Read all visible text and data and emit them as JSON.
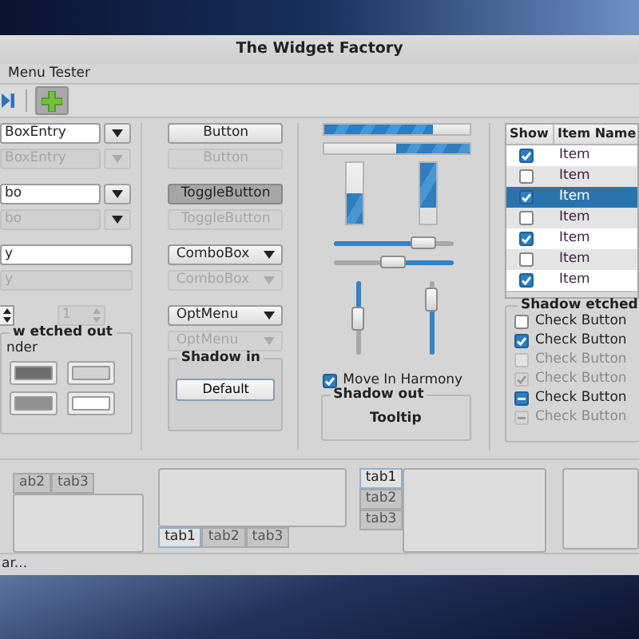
{
  "window": {
    "title": "The Widget Factory"
  },
  "menu": [
    "Menu Tester"
  ],
  "toolbar": [
    {
      "pressed": false
    },
    {
      "pressed": true
    }
  ],
  "entries": [
    {
      "kind": "combo-entry",
      "value": "BoxEntry",
      "disabled": false
    },
    {
      "kind": "combo-entry",
      "value": "BoxEntry",
      "disabled": true
    },
    {
      "kind": "combo",
      "value": "bo",
      "disabled": false
    },
    {
      "kind": "combo",
      "value": "bo",
      "disabled": true
    },
    {
      "kind": "entry",
      "value": "y",
      "disabled": false
    },
    {
      "kind": "entry",
      "value": "y",
      "disabled": true
    }
  ],
  "spins": [
    {
      "disabled": false
    },
    {
      "value": "1",
      "disabled": true
    }
  ],
  "etched_out_frame": {
    "label": "w etched out",
    "sublabel": "nder",
    "swatches": [
      {
        "color": "#6e6e6e"
      },
      {
        "color": "#d2d2d2"
      },
      {
        "color": "#8f8f8f"
      },
      {
        "color": "#ffffff"
      }
    ]
  },
  "buttons": [
    {
      "kind": "button",
      "label": "Button",
      "disabled": false,
      "pressed": false
    },
    {
      "kind": "button",
      "label": "Button",
      "disabled": true,
      "pressed": false
    },
    {
      "kind": "toggle",
      "label": "ToggleButton",
      "disabled": false,
      "pressed": true
    },
    {
      "kind": "toggle",
      "label": "ToggleButton",
      "disabled": true,
      "pressed": false
    },
    {
      "kind": "combo",
      "label": "ComboBox",
      "disabled": false,
      "pressed": false
    },
    {
      "kind": "combo",
      "label": "ComboBox",
      "disabled": true,
      "pressed": false
    },
    {
      "kind": "optmenu",
      "label": "OptMenu",
      "disabled": false,
      "pressed": false
    },
    {
      "kind": "optmenu",
      "label": "OptMenu",
      "disabled": true,
      "pressed": false
    }
  ],
  "shadow_in_frame": {
    "label": "Shadow in",
    "button": "Default"
  },
  "progress_bars": [
    {
      "kind": "horizontal",
      "inverted": false,
      "level": 0.75
    },
    {
      "kind": "horizontal",
      "inverted": true,
      "level": 0.5
    },
    {
      "kind": "vertical",
      "inverted": false,
      "level": 0.5
    },
    {
      "kind": "vertical",
      "inverted": true,
      "level": 0.73
    }
  ],
  "scales": [
    {
      "kind": "horizontal",
      "inverted": false,
      "level": 0.75
    },
    {
      "kind": "horizontal",
      "inverted": true,
      "level": 0.5
    },
    {
      "kind": "vertical",
      "inverted": true,
      "level": 0.5
    },
    {
      "kind": "vertical",
      "inverted": false,
      "level": 0.76
    }
  ],
  "harmony": {
    "label": "Move In Harmony",
    "checked": true
  },
  "shadow_out_frame": {
    "label": "Shadow out",
    "text": "Tooltip"
  },
  "tree": {
    "columns": [
      "Show",
      "Item Name"
    ],
    "rows": [
      {
        "checked": true,
        "name": "Item",
        "selected": false
      },
      {
        "checked": false,
        "name": "Item",
        "selected": false
      },
      {
        "checked": true,
        "name": "Item",
        "selected": true
      },
      {
        "checked": false,
        "name": "Item",
        "selected": false
      },
      {
        "checked": true,
        "name": "Item",
        "selected": false
      },
      {
        "checked": false,
        "name": "Item",
        "selected": false
      },
      {
        "checked": true,
        "name": "Item",
        "selected": false
      }
    ]
  },
  "shadow_etched_frame": {
    "label": "Shadow etched",
    "checks": [
      {
        "label": "Check Button",
        "checked": false,
        "inconsistent": false,
        "disabled": false
      },
      {
        "label": "Check Button",
        "checked": true,
        "inconsistent": false,
        "disabled": false
      },
      {
        "label": "Check Button",
        "checked": false,
        "inconsistent": false,
        "disabled": true
      },
      {
        "label": "Check Button",
        "checked": true,
        "inconsistent": false,
        "disabled": true
      },
      {
        "label": "Check Button",
        "inconsistent": true,
        "disabled": false
      },
      {
        "label": "Check Button",
        "inconsistent": true,
        "disabled": true
      }
    ]
  },
  "notebooks": [
    {
      "kind": "top",
      "tabs": [
        {
          "label": "ab2",
          "selected": false
        },
        {
          "label": "tab3",
          "selected": false
        }
      ]
    },
    {
      "kind": "bottom",
      "tabs": [
        {
          "label": "tab1",
          "selected": true
        },
        {
          "label": "tab2",
          "selected": false
        },
        {
          "label": "tab3",
          "selected": false
        }
      ]
    },
    {
      "kind": "left",
      "tabs": [
        {
          "label": "tab1",
          "selected": true
        },
        {
          "label": "tab2",
          "selected": false
        },
        {
          "label": "tab3",
          "selected": false
        }
      ]
    }
  ],
  "status_bar": "ar..."
}
